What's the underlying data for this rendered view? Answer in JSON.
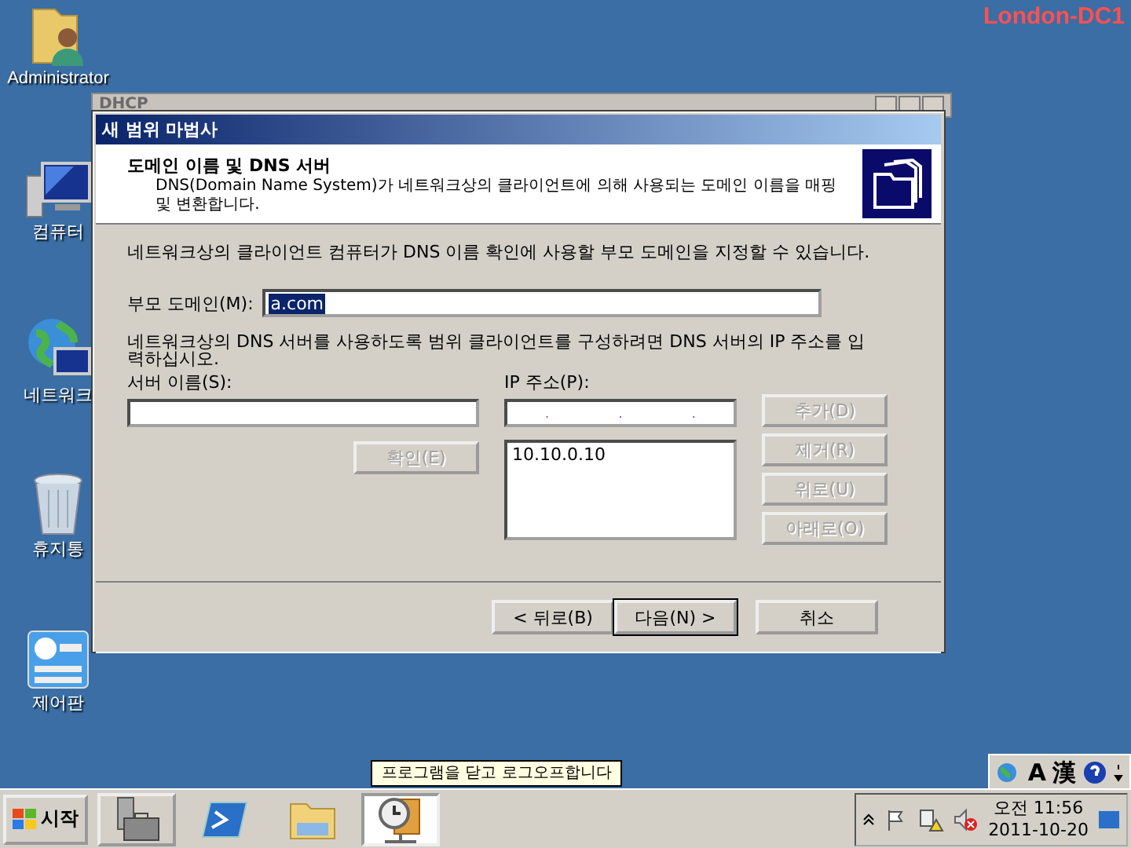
{
  "desktop": {
    "watermark_label": "London-DC1",
    "icons": [
      {
        "label": "Administrator",
        "kind": "user-folder"
      },
      {
        "label": "컴퓨터",
        "kind": "computer"
      },
      {
        "label": "네트워크",
        "kind": "network"
      },
      {
        "label": "휴지통",
        "kind": "recycle"
      },
      {
        "label": "제어판",
        "kind": "control"
      }
    ]
  },
  "background_window": {
    "title": "DHCP"
  },
  "wizard": {
    "title": "새 범위 마법사",
    "header": {
      "title": "도메인 이름 및 DNS 서버",
      "description": "DNS(Domain Name System)가 네트워크상의 클라이언트에 의해 사용되는 도메인 이름을 매핑 및 변환합니다."
    },
    "intro": "네트워크상의 클라이언트 컴퓨터가 DNS 이름 확인에 사용할 부모 도메인을 지정할 수 있습니다.",
    "parent_domain": {
      "label": "부모 도메인(M):",
      "value": "a.com",
      "selected": true
    },
    "dns_hint": "네트워크상의 DNS 서버를 사용하도록 범위 클라이언트를 구성하려면 DNS 서버의 IP 주소를 입력하십시오.",
    "server_name": {
      "label": "서버 이름(S):"
    },
    "resolve_button": {
      "label": "확인(E)",
      "disabled": true
    },
    "ip_address": {
      "label": "IP 주소(P):",
      "separators": [
        ".",
        ".",
        "."
      ]
    },
    "ip_list": [
      "10.10.0.10"
    ],
    "side_buttons": [
      {
        "label": "추가(D)",
        "disabled": true
      },
      {
        "label": "제거(R)",
        "disabled": true
      },
      {
        "label": "위로(U)",
        "disabled": true
      },
      {
        "label": "아래로(O)",
        "disabled": true
      }
    ],
    "footer_buttons": [
      {
        "label": "< 뒤로(B)",
        "default": false
      },
      {
        "label": "다음(N) >",
        "default": true
      },
      {
        "label": "취소",
        "default": false
      }
    ]
  },
  "tooltip": "프로그램을 닫고 로그오프합니다",
  "language_bar": {
    "items": [
      "A",
      "漢"
    ]
  },
  "taskbar": {
    "start_label": "시작",
    "apps": [
      {
        "kind": "server-manager",
        "selected": false
      },
      {
        "kind": "powershell",
        "selected": false
      },
      {
        "kind": "explorer",
        "selected": false
      },
      {
        "kind": "dhcp",
        "selected": true
      }
    ],
    "clock": {
      "time": "오전 11:56",
      "date": "2011-10-20"
    }
  }
}
